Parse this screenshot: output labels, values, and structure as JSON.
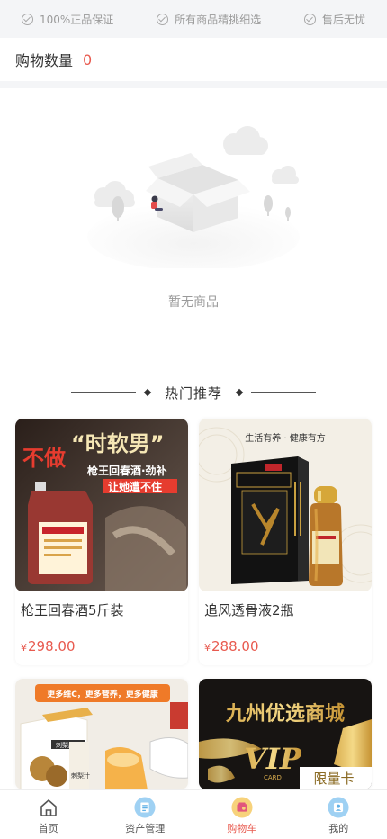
{
  "guarantees": [
    {
      "label": "100%正品保证",
      "icon": "check-circle-icon"
    },
    {
      "label": "所有商品精挑细选",
      "icon": "check-circle-icon"
    },
    {
      "label": "售后无忧",
      "icon": "check-circle-icon"
    }
  ],
  "cart": {
    "count_label": "购物数量",
    "count_value": "0",
    "empty_text": "暂无商品"
  },
  "hot": {
    "title": "热门推荐"
  },
  "products": [
    {
      "name": "枪王回春酒5斤装",
      "currency": "¥",
      "price": "298.00",
      "image_text": [
        "不做",
        "“时软男”",
        "枪王回春酒·劲补",
        "让她遭不住"
      ]
    },
    {
      "name": "追风透骨液2瓶",
      "currency": "¥",
      "price": "288.00",
      "image_text": [
        "生活有养 · 健康有方"
      ]
    },
    {
      "name": "",
      "currency": "",
      "price": "",
      "image_text": [
        "更多维C，更多营养，更多健康",
        "刺梨原汁",
        "刺梨汁"
      ]
    },
    {
      "name": "",
      "currency": "",
      "price": "",
      "image_text": [
        "九州优选商城",
        "VIP",
        "CARD",
        "限量卡"
      ]
    }
  ],
  "tabbar": {
    "items": [
      {
        "label": "首页",
        "icon": "home-icon"
      },
      {
        "label": "资产管理",
        "icon": "asset-icon"
      },
      {
        "label": "购物车",
        "icon": "cart-icon",
        "active": true
      },
      {
        "label": "我的",
        "icon": "profile-icon"
      }
    ]
  },
  "colors": {
    "accent": "#e85a4f",
    "muted": "#9a9a9a",
    "background": "#f4f5f7"
  }
}
